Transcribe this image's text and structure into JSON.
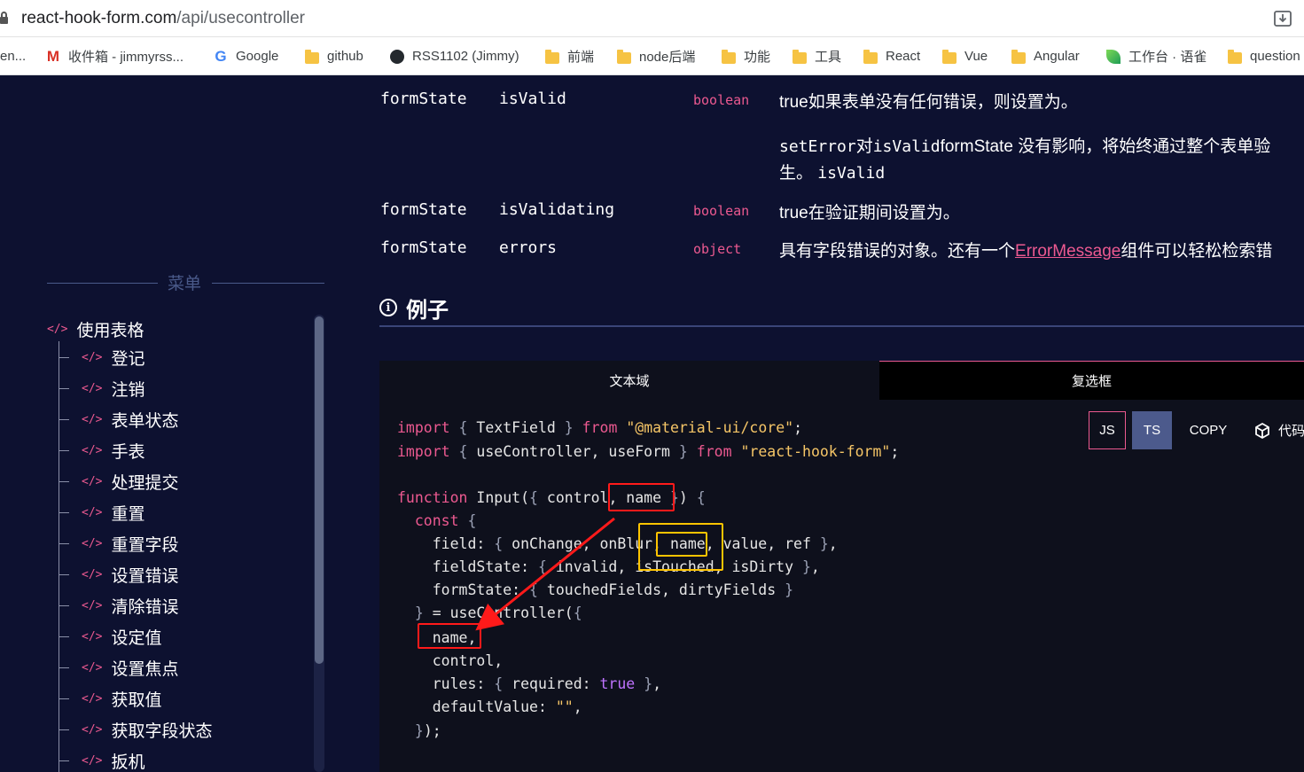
{
  "browser": {
    "url_host": "react-hook-form.com",
    "url_path": "/api/usecontroller"
  },
  "bookmarks": [
    {
      "label": "en...",
      "icon": "none"
    },
    {
      "label": "收件箱 - jimmyrss...",
      "icon": "gmail-icon"
    },
    {
      "label": "Google",
      "icon": "google-icon"
    },
    {
      "label": "github",
      "icon": "folder-icon"
    },
    {
      "label": "RSS1102 (Jimmy)",
      "icon": "github-icon"
    },
    {
      "label": "前端",
      "icon": "folder-icon"
    },
    {
      "label": "node后端",
      "icon": "folder-icon"
    },
    {
      "label": "功能",
      "icon": "folder-icon"
    },
    {
      "label": "工具",
      "icon": "folder-icon"
    },
    {
      "label": "React",
      "icon": "folder-icon"
    },
    {
      "label": "Vue",
      "icon": "folder-icon"
    },
    {
      "label": "Angular",
      "icon": "folder-icon"
    },
    {
      "label": "工作台 · 语雀",
      "icon": "yuque-icon"
    },
    {
      "label": "question",
      "icon": "folder-icon"
    }
  ],
  "sidebar": {
    "menu_title": "菜单",
    "code_icon": "</>",
    "section": "使用表格",
    "items": [
      "登记",
      "注销",
      "表单状态",
      "手表",
      "处理提交",
      "重置",
      "重置字段",
      "设置错误",
      "清除错误",
      "设定值",
      "设置焦点",
      "获取值",
      "获取字段状态",
      "扳机"
    ]
  },
  "props": [
    {
      "group": "formState",
      "name": "isValid",
      "type": "boolean",
      "desc": "true如果表单没有任何错误，则设置为。"
    },
    {
      "group": "formState",
      "name": "isValidating",
      "type": "boolean",
      "desc": "true在验证期间设置为。"
    },
    {
      "group": "formState",
      "name": "errors",
      "type": "object",
      "desc_before": "具有字段错误的对象。还有一个",
      "desc_link": "ErrorMessage",
      "desc_after": "组件可以轻松检索错"
    }
  ],
  "isvalid_note": {
    "line1_code": "setError",
    "line1_a": "对",
    "line1_code2": "isValid",
    "line1_b": "formState 没有影响，将始终通过整个表单验",
    "line2_a": "生。",
    "line2_code": "isValid"
  },
  "example": {
    "title": "例子",
    "tabs": [
      "文本域",
      "复选框"
    ],
    "buttons": {
      "js": "JS",
      "ts": "TS",
      "copy": "COPY",
      "sandbox": "代码"
    }
  }
}
